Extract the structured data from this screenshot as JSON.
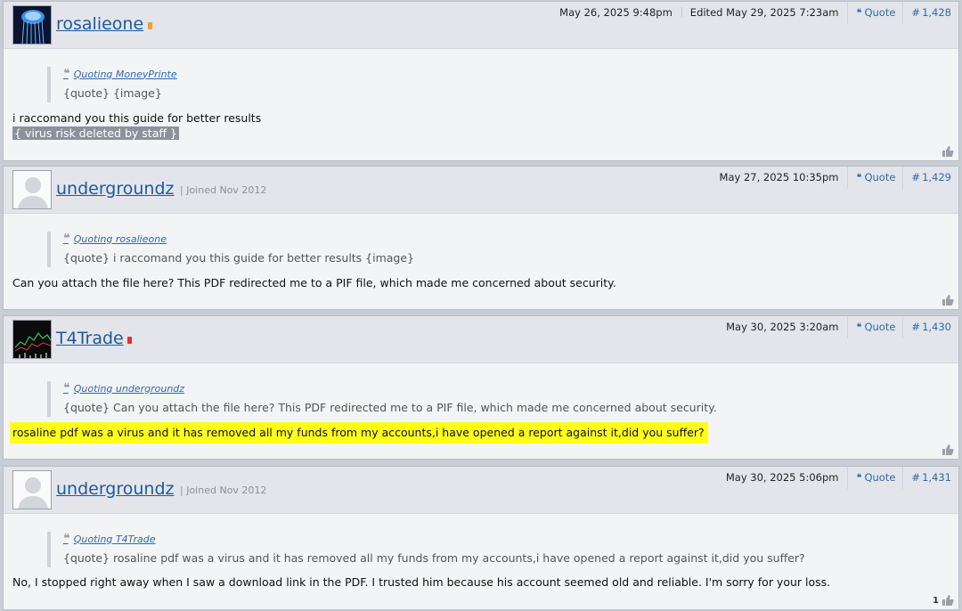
{
  "posts": [
    {
      "username": "rosalieone",
      "date": "May 26, 2025 9:48pm",
      "edited": "Edited May 29, 2025 7:23am",
      "quote_label": "Quote",
      "post_number": "1,428",
      "quote_source": "Quoting MoneyPrinte",
      "quote_text": "{quote} {image}",
      "message": "i raccomand you this guide for better results",
      "deleted_text": "{ virus risk deleted by staff }"
    },
    {
      "username": "undergroundz",
      "joined": "| Joined Nov 2012",
      "date": "May 27, 2025 10:35pm",
      "quote_label": "Quote",
      "post_number": "1,429",
      "quote_source": "Quoting rosalieone",
      "quote_text": "{quote} i raccomand you this guide for better results {image}",
      "message": "Can you attach the file here? This PDF redirected me to a PIF file, which made me concerned about security."
    },
    {
      "username": "T4Trade",
      "date": "May 30, 2025 3:20am",
      "quote_label": "Quote",
      "post_number": "1,430",
      "quote_source": "Quoting undergroundz",
      "quote_text": "{quote} Can you attach the file here? This PDF redirected me to a PIF file, which made me concerned about security.",
      "message": "rosaline pdf was a virus and it has removed all my funds from my accounts,i have opened a report against it,did you suffer?"
    },
    {
      "username": "undergroundz",
      "joined": "| Joined Nov 2012",
      "date": "May 30, 2025 5:06pm",
      "quote_label": "Quote",
      "post_number": "1,431",
      "quote_source": "Quoting T4Trade",
      "quote_text": "{quote} rosaline pdf was a virus and it has removed all my funds from my accounts,i have opened a report against it,did you suffer?",
      "message": "No, I stopped right away when I saw a download link in the PDF. I trusted him because his account seemed old and reliable. I'm sorry for your loss.",
      "like_count": "1"
    }
  ],
  "icons": {
    "quote": "quote-icon",
    "hash": "#",
    "like": "thumbs-up-icon"
  },
  "colors": {
    "link": "#1d5a9c",
    "highlight": "#ffff1a",
    "badge_orange": "#f0a030",
    "badge_red": "#e03030"
  }
}
